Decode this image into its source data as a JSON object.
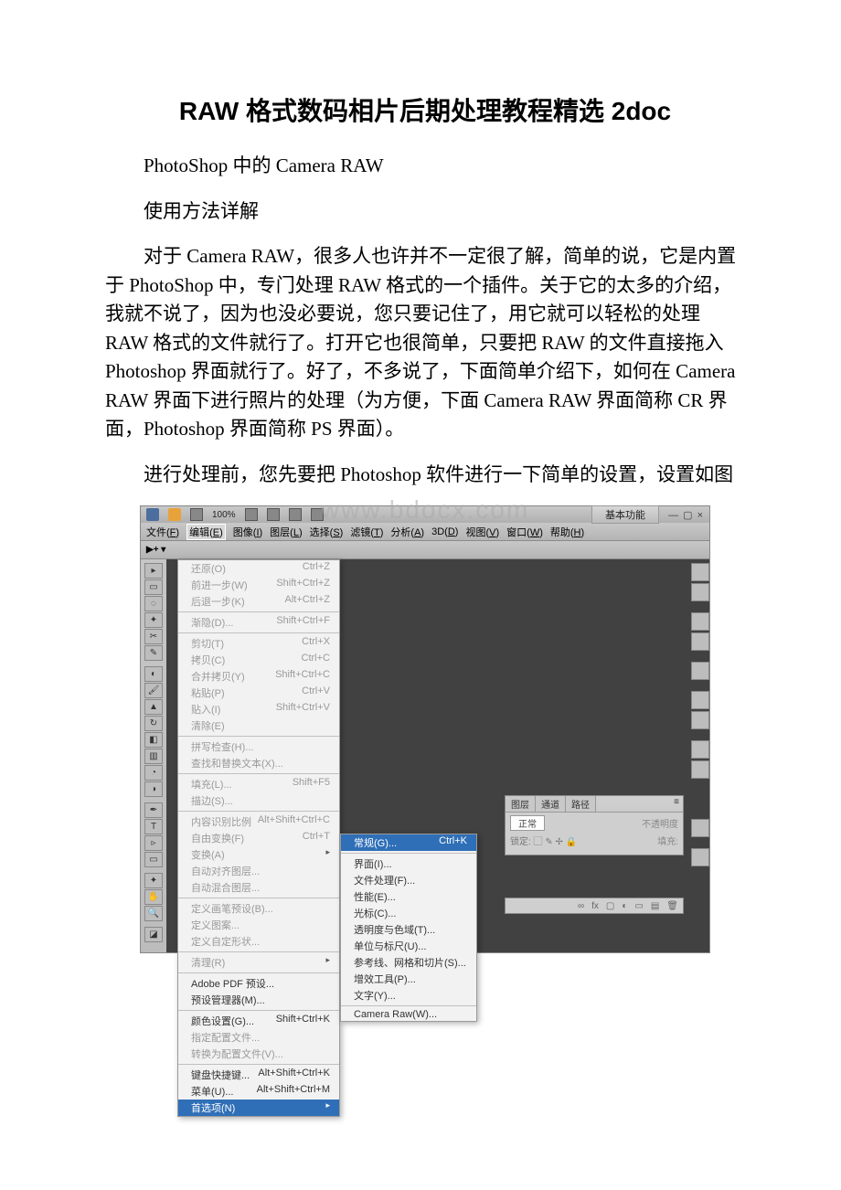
{
  "title": "RAW 格式数码相片后期处理教程精选 2doc",
  "p1": "PhotoShop 中的 Camera RAW",
  "p2": "使用方法详解",
  "p3": "对于 Camera RAW，很多人也许并不一定很了解，简单的说，它是内置于 PhotoShop 中，专门处理 RAW 格式的一个插件。关于它的太多的介绍，我就不说了，因为也没必要说，您只要记住了，用它就可以轻松的处理 RAW 格式的文件就行了。打开它也很简单，只要把 RAW 的文件直接拖入 Photoshop 界面就行了。好了，不多说了，下面简单介绍下，如何在 Camera RAW 界面下进行照片的处理（为方便，下面 Camera RAW 界面简称 CR 界面，Photoshop 界面简称 PS 界面）。",
  "p4": "进行处理前，您先要把 Photoshop 软件进行一下简单的设置，设置如图",
  "watermark": "www.bdocx.com",
  "ps": {
    "zoom": "100%",
    "essentials": "基本功能",
    "winbtns": "— ▢ ×",
    "menubar": [
      {
        "l": "文件",
        "k": "F"
      },
      {
        "l": "编辑",
        "k": "E"
      },
      {
        "l": "图像",
        "k": "I"
      },
      {
        "l": "图层",
        "k": "L"
      },
      {
        "l": "选择",
        "k": "S"
      },
      {
        "l": "滤镜",
        "k": "T"
      },
      {
        "l": "分析",
        "k": "A"
      },
      {
        "l": "3D",
        "k": "D"
      },
      {
        "l": "视图",
        "k": "V"
      },
      {
        "l": "窗口",
        "k": "W"
      },
      {
        "l": "帮助",
        "k": "H"
      }
    ],
    "tooltip_move": "▶+ ▾",
    "edit_menu": [
      {
        "l": "还原(O)",
        "s": "Ctrl+Z",
        "dim": true
      },
      {
        "l": "前进一步(W)",
        "s": "Shift+Ctrl+Z",
        "dim": true
      },
      {
        "l": "后退一步(K)",
        "s": "Alt+Ctrl+Z",
        "dim": true
      },
      {
        "hr": true
      },
      {
        "l": "渐隐(D)...",
        "s": "Shift+Ctrl+F",
        "dim": true
      },
      {
        "hr": true
      },
      {
        "l": "剪切(T)",
        "s": "Ctrl+X",
        "dim": true
      },
      {
        "l": "拷贝(C)",
        "s": "Ctrl+C",
        "dim": true
      },
      {
        "l": "合并拷贝(Y)",
        "s": "Shift+Ctrl+C",
        "dim": true
      },
      {
        "l": "粘贴(P)",
        "s": "Ctrl+V",
        "dim": true
      },
      {
        "l": "贴入(I)",
        "s": "Shift+Ctrl+V",
        "dim": true
      },
      {
        "l": "清除(E)",
        "dim": true
      },
      {
        "hr": true
      },
      {
        "l": "拼写检查(H)...",
        "dim": true
      },
      {
        "l": "查找和替换文本(X)...",
        "dim": true
      },
      {
        "hr": true
      },
      {
        "l": "填充(L)...",
        "s": "Shift+F5",
        "dim": true
      },
      {
        "l": "描边(S)...",
        "dim": true
      },
      {
        "hr": true
      },
      {
        "l": "内容识别比例",
        "s": "Alt+Shift+Ctrl+C",
        "dim": true
      },
      {
        "l": "自由变换(F)",
        "s": "Ctrl+T",
        "dim": true
      },
      {
        "l": "变换(A)",
        "arrow": true,
        "dim": true
      },
      {
        "l": "自动对齐图层...",
        "dim": true
      },
      {
        "l": "自动混合图层...",
        "dim": true
      },
      {
        "hr": true
      },
      {
        "l": "定义画笔预设(B)...",
        "dim": true
      },
      {
        "l": "定义图案...",
        "dim": true
      },
      {
        "l": "定义自定形状...",
        "dim": true
      },
      {
        "hr": true
      },
      {
        "l": "清理(R)",
        "arrow": true,
        "dim": true
      },
      {
        "hr": true
      },
      {
        "l": "Adobe PDF 预设..."
      },
      {
        "l": "预设管理器(M)..."
      },
      {
        "hr": true
      },
      {
        "l": "颜色设置(G)...",
        "s": "Shift+Ctrl+K"
      },
      {
        "l": "指定配置文件...",
        "dim": true
      },
      {
        "l": "转换为配置文件(V)...",
        "dim": true
      },
      {
        "hr": true
      },
      {
        "l": "键盘快捷键...",
        "s": "Alt+Shift+Ctrl+K"
      },
      {
        "l": "菜单(U)...",
        "s": "Alt+Shift+Ctrl+M"
      },
      {
        "l": "首选项(N)",
        "arrow": true,
        "hl": true
      }
    ],
    "pref_submenu": [
      {
        "l": "常规(G)...",
        "s": "Ctrl+K",
        "hl": true
      },
      {
        "hr": true
      },
      {
        "l": "界面(I)..."
      },
      {
        "l": "文件处理(F)..."
      },
      {
        "l": "性能(E)..."
      },
      {
        "l": "光标(C)..."
      },
      {
        "l": "透明度与色域(T)..."
      },
      {
        "l": "单位与标尺(U)..."
      },
      {
        "l": "参考线、网格和切片(S)..."
      },
      {
        "l": "增效工具(P)..."
      },
      {
        "l": "文字(Y)..."
      },
      {
        "hr": true
      },
      {
        "l": "Camera Raw(W)..."
      }
    ],
    "panels": {
      "layers_tabs": [
        "图层",
        "通道",
        "路径"
      ],
      "layers_mode": "正常",
      "layers_opacity": "不透明度",
      "layers_lock": "锁定: ▢ ✎ ✢ 🔒",
      "layers_fill": "填充:"
    }
  }
}
